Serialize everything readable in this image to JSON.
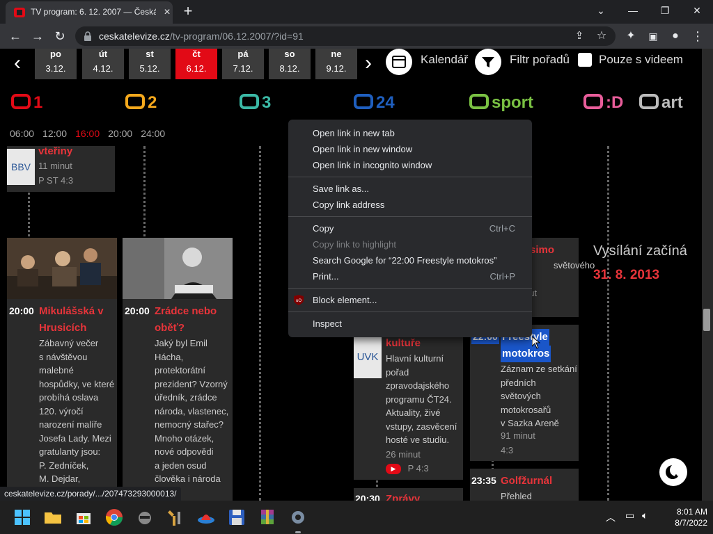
{
  "browser": {
    "tab_title": "TV program: 6. 12. 2007 — Česká",
    "url_domain": "ceskatelevize.cz",
    "url_path": "/tv-program/06.12.2007/?id=91",
    "status_url": "ceskatelevize.cz/porady/.../207473293000013/"
  },
  "days": [
    {
      "name": "po",
      "date": "3.12."
    },
    {
      "name": "út",
      "date": "4.12."
    },
    {
      "name": "st",
      "date": "5.12."
    },
    {
      "name": "čt",
      "date": "6.12.",
      "selected": true
    },
    {
      "name": "pá",
      "date": "7.12."
    },
    {
      "name": "so",
      "date": "8.12."
    },
    {
      "name": "ne",
      "date": "9.12."
    }
  ],
  "header": {
    "calendar_label": "Kalendář",
    "filter_label": "Filtr pořadů",
    "video_only_label": "Pouze s videem"
  },
  "channels": [
    {
      "name": "1",
      "color": "#e20a16"
    },
    {
      "name": "2",
      "color": "#f5a81c"
    },
    {
      "name": "3",
      "color": "#3bb9a6"
    },
    {
      "name": "24",
      "color": "#1f5fbf"
    },
    {
      "name": "sport",
      "color": "#7ac143"
    },
    {
      "name": ":D",
      "color": "#e85d9a"
    },
    {
      "name": "art",
      "color": "#bbbbbb"
    }
  ],
  "times": [
    "06:00",
    "12:00",
    "16:00",
    "20:00",
    "24:00"
  ],
  "programs": {
    "p1": {
      "title": "vteřiny",
      "duration": "11 minut",
      "flags": "P  ST  4:3",
      "logo": "BBV"
    },
    "p2": {
      "time": "20:00",
      "title1": "Mikulášská v",
      "title2": "Hrusicích",
      "desc": [
        "Zábavný večer",
        "s návštěvou",
        "malebné",
        "hospůdky, ve které",
        "probíhá oslava",
        "120. výročí",
        "narození malíře",
        "Josefa Lady. Mezi",
        "gratulanty jsou:",
        "P. Zedníček,",
        "M. Dejdar,"
      ]
    },
    "p3": {
      "time": "20:00",
      "title1": "Zrádce nebo",
      "title2": "oběť?",
      "desc": [
        "Jaký byl Emil",
        "Hácha,",
        "protektorátní",
        "prezident? Vzorný",
        "úředník, zrádce",
        "národa, vlastenec,",
        "nemocný stařec?",
        "Mnoho otázek,",
        "nové odpovědi",
        "a jeden osud",
        "člověka i národa"
      ]
    },
    "p4": {
      "title": "kultuře",
      "logo": "UVK",
      "desc": [
        "Hlavní kulturní",
        "pořad",
        "zpravodajského",
        "programu ČT24.",
        "Aktuality, živé",
        "vstupy, zasvěcení",
        "hosté ve studiu."
      ],
      "duration": "26 minut",
      "flags": "P  4:3"
    },
    "p5": {
      "title_part": "simo",
      "desc_part": "světového",
      "meta_part": "nut"
    },
    "p6": {
      "time": "22:00",
      "title1": "Freestyle",
      "title2": "motokros",
      "desc": [
        "Záznam ze setkání",
        "předních",
        "světových",
        "motokrosařů",
        "v Sazka Areně"
      ],
      "duration": "91 minut",
      "flags": "4:3"
    },
    "p7": {
      "time": "23:35",
      "title": "Golfžurnál",
      "desc": "Přehled"
    },
    "p8": {
      "time": "20:30",
      "title": "Zprávy"
    }
  },
  "side": {
    "text": "Vysílání začíná",
    "date": "31. 8. 2013"
  },
  "context_menu": {
    "open_new_tab": "Open link in new tab",
    "open_new_window": "Open link in new window",
    "open_incognito": "Open link in incognito window",
    "save_link": "Save link as...",
    "copy_link_address": "Copy link address",
    "copy": "Copy",
    "copy_shortcut": "Ctrl+C",
    "copy_highlight": "Copy link to highlight",
    "search_google": "Search Google for “22:00 Freestyle motokros”",
    "print": "Print...",
    "print_shortcut": "Ctrl+P",
    "block_element": "Block element...",
    "inspect": "Inspect"
  },
  "taskbar": {
    "time": "8:01 AM",
    "date": "8/7/2022"
  }
}
